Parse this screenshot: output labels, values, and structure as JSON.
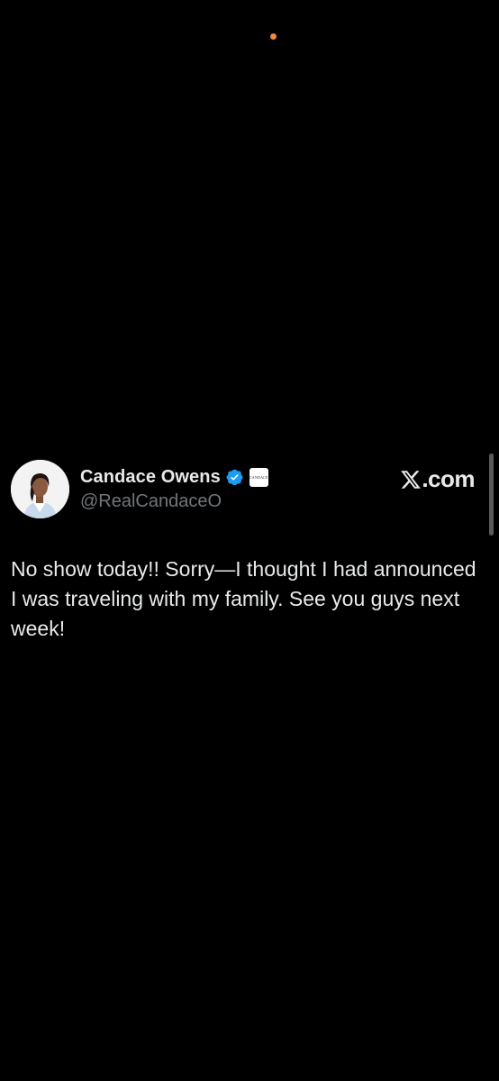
{
  "tweet": {
    "display_name": "Candace Owens",
    "handle": "@RealCandaceO",
    "affiliate_badge_text": "CANDACE",
    "site_label": ".com",
    "text": "No show today!! Sorry—I thought I had announced I was traveling with my family. See you guys next week!",
    "verified_color": "#1d9bf0"
  },
  "icons": {
    "verified": "verified-badge-icon",
    "x_logo": "x-logo-icon",
    "avatar": "profile-photo"
  },
  "colors": {
    "background": "#000000",
    "text_primary": "#e7e9ea",
    "text_secondary": "#71767b",
    "accent": "#1d9bf0",
    "status_dot": "#f0883e"
  }
}
